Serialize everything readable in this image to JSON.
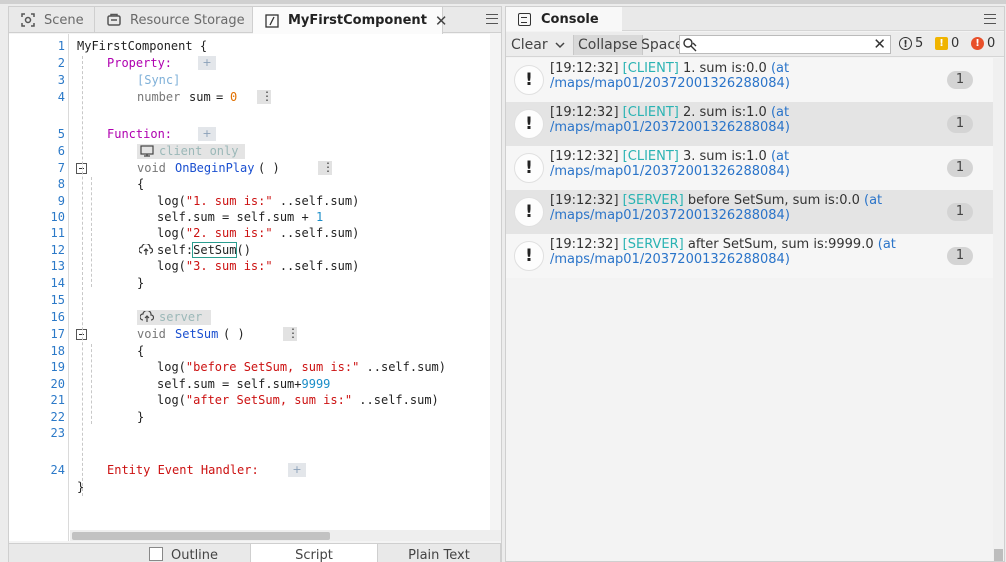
{
  "left_tabs": [
    {
      "label": "Scene",
      "icon": "scene-icon"
    },
    {
      "label": "Resource Storage",
      "icon": "storage-icon"
    },
    {
      "label": "MyFirstComponent",
      "icon": "script-icon",
      "active": true,
      "close": "✕"
    }
  ],
  "code": {
    "line_numbers": [
      "1",
      "2",
      "3",
      "4",
      "5",
      "6",
      "7",
      "8",
      "9",
      "10",
      "11",
      "12",
      "13",
      "14",
      "15",
      "16",
      "17",
      "18",
      "19",
      "20",
      "21",
      "22",
      "23",
      "24"
    ],
    "component_open": "MyFirstComponent {",
    "property_label": "Property:",
    "sync_label": "[Sync]",
    "prop_type": "number",
    "prop_name": "sum",
    "prop_eq": "=",
    "prop_value": "0",
    "function_label": "Function:",
    "client_only_tag": "client only",
    "void1": "void",
    "func1_name": "OnBeginPlay",
    "func1_parens": "( )",
    "brace_open": "{",
    "brace_close": "}",
    "f1_l1_pre": "log(",
    "f1_l1_str": "\"1. sum is:\"",
    "f1_l1_post": " ..self.sum)",
    "f1_l2_pre": "self.sum = self.sum + ",
    "f1_l2_num": "1",
    "f1_l3_pre": "log(",
    "f1_l3_str": "\"2. sum is:\"",
    "f1_l3_post": " ..self.sum)",
    "f1_l4_pre": "self:",
    "f1_l4_call": "SetSum",
    "f1_l4_post": "()",
    "f1_l5_pre": "log(",
    "f1_l5_str": "\"3. sum is:\"",
    "f1_l5_post": " ..self.sum)",
    "server_tag": "server",
    "void2": "void",
    "func2_name": "SetSum",
    "func2_parens": "( )",
    "f2_l1_pre": "log(",
    "f2_l1_str": "\"before SetSum, sum is:\"",
    "f2_l1_post": " ..self.sum)",
    "f2_l2_pre": "self.sum = self.sum+",
    "f2_l2_num": "9999",
    "f2_l3_pre": "log(",
    "f2_l3_str": "\"after SetSum, sum is:\"",
    "f2_l3_post": " ..self.sum)",
    "entity_label": "Entity Event Handler:",
    "plus": "+"
  },
  "bottom_tabs": [
    {
      "label": "Outline"
    },
    {
      "label": "Script",
      "active": true
    },
    {
      "label": "Plain Text"
    }
  ],
  "console": {
    "title": "Console",
    "toolbar": {
      "clear": "Clear",
      "dropdown_icon": "chevron-down-icon",
      "collapse": "Collapse",
      "space": "Space",
      "search_placeholder": "",
      "info_count": "5",
      "warning_count": "0",
      "error_count": "0"
    },
    "entries": [
      {
        "time": "[19:12:32]",
        "tag": "[CLIENT]",
        "text": "1. sum is:0.0",
        "link_a": "(at",
        "link_b": "/maps/map01/20372001326288084)",
        "count": "1"
      },
      {
        "time": "[19:12:32]",
        "tag": "[CLIENT]",
        "text": "2. sum is:1.0",
        "link_a": "(at",
        "link_b": "/maps/map01/20372001326288084)",
        "count": "1"
      },
      {
        "time": "[19:12:32]",
        "tag": "[CLIENT]",
        "text": "3. sum is:1.0",
        "link_a": "(at",
        "link_b": "/maps/map01/20372001326288084)",
        "count": "1"
      },
      {
        "time": "[19:12:32]",
        "tag": "[SERVER]",
        "text": "before SetSum, sum is:0.0",
        "link_a": "(at",
        "link_b": "/maps/map01/20372001326288084)",
        "count": "1"
      },
      {
        "time": "[19:12:32]",
        "tag": "[SERVER]",
        "text": "after SetSum, sum is:9999.0",
        "link_a": "(at",
        "link_b": "/maps/map01/20372001326288084)",
        "count": "1"
      }
    ]
  }
}
